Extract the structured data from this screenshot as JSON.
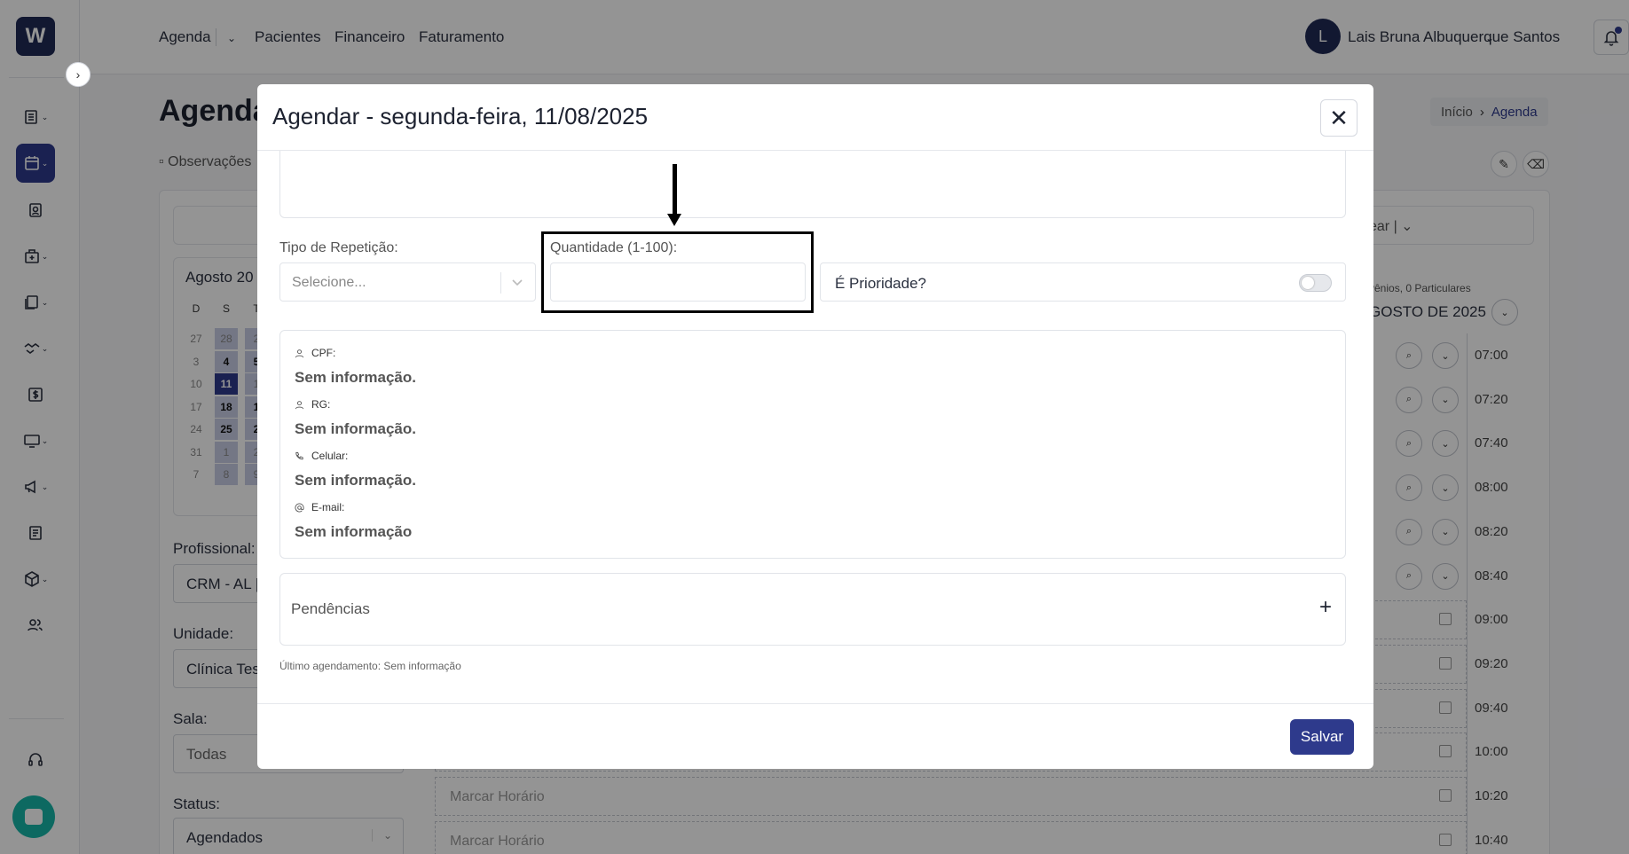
{
  "nav": {
    "items": [
      "Agenda",
      "Pacientes",
      "Financeiro",
      "Faturamento"
    ],
    "user_initial": "L",
    "user_name": "Lais Bruna Albuquerque Santos"
  },
  "page": {
    "title": "Agenda",
    "breadcrumb_home": "Início",
    "breadcrumb_current": "Agenda",
    "observacoes": "Observações",
    "filter_text": "ear"
  },
  "calendar": {
    "title": "Agosto 20",
    "weekdays": [
      "D",
      "S",
      "T"
    ],
    "rows": [
      [
        "27",
        "28",
        "2"
      ],
      [
        "3",
        "4",
        "5"
      ],
      [
        "10",
        "11",
        "1"
      ],
      [
        "17",
        "18",
        "1"
      ],
      [
        "24",
        "25",
        "2"
      ],
      [
        "31",
        "1",
        "2"
      ],
      [
        "7",
        "8",
        "9"
      ]
    ]
  },
  "filters": {
    "profissional_label": "Profissional:",
    "profissional_value": "CRM - AL |",
    "unidade_label": "Unidade:",
    "unidade_value": "Clínica Tes",
    "sala_label": "Sala:",
    "sala_value": "Todas",
    "status_label": "Status:",
    "status_value": "Agendados"
  },
  "schedule": {
    "header": "vênios, 0 Particulares",
    "month": "GOSTO DE 2025",
    "times": [
      "07:00",
      "07:20",
      "07:40",
      "08:00",
      "08:20",
      "08:40",
      "09:00",
      "09:20",
      "09:40",
      "10:00",
      "10:20",
      "10:40"
    ],
    "slot_label": "Marcar Horário"
  },
  "modal": {
    "title": "Agendar - segunda-feira, 11/08/2025",
    "repeticao_label": "Tipo de Repetição:",
    "repeticao_placeholder": "Selecione...",
    "quantidade_label": "Quantidade (1-100):",
    "quantidade_value": "",
    "prioridade_label": "É Prioridade?",
    "prioridade_on": false,
    "cpf_label": "CPF:",
    "cpf_value": "Sem informação.",
    "rg_label": "RG:",
    "rg_value": "Sem informação.",
    "celular_label": "Celular:",
    "celular_value": "Sem informação.",
    "email_label": "E-mail:",
    "email_value": "Sem informação",
    "pendencias_label": "Pendências",
    "ultimo_agendamento": "Último agendamento: Sem informação",
    "save_label": "Salvar"
  },
  "colors": {
    "brand": "#2e3a8c",
    "chat": "#17b5a8"
  }
}
